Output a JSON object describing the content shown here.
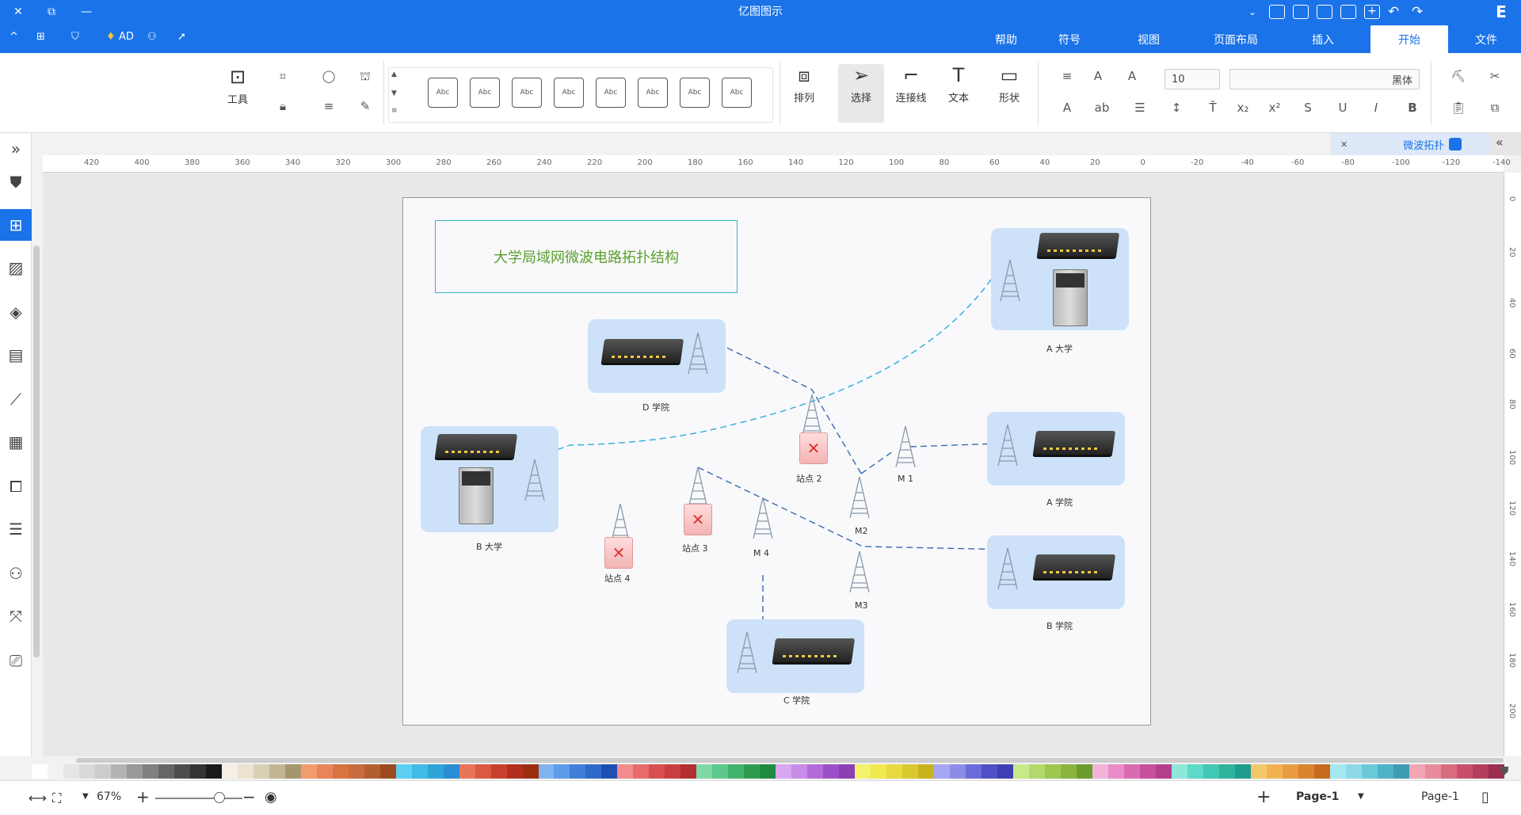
{
  "app": {
    "title": "亿图图示"
  },
  "titlebar": {
    "mirror_logo": "E",
    "quick_icons": [
      "redo-icon",
      "undo-icon",
      "new-icon",
      "open-icon",
      "save-icon",
      "print-icon",
      "export-icon",
      "more-icon"
    ]
  },
  "menubar": {
    "tabs": [
      {
        "label": "文件",
        "active": false
      },
      {
        "label": "开始",
        "active": true
      },
      {
        "label": "插入",
        "active": false
      },
      {
        "label": "页面布局",
        "active": false
      },
      {
        "label": "视图",
        "active": false
      },
      {
        "label": "符号",
        "active": false
      },
      {
        "label": "帮助",
        "active": false
      }
    ],
    "right_items": {
      "ad": "AD"
    }
  },
  "ribbon": {
    "font_name": "黑体",
    "font_size": "10",
    "shape_label": "形状",
    "text_label": "文本",
    "connector_label": "连接线",
    "select_label": "选择",
    "arrange_label": "排列",
    "tools_label": "工具",
    "style_box_label": "Abc",
    "style_count": 8
  },
  "doc_tab": {
    "name": "微波拓扑"
  },
  "ruler_top": {
    "ticks": [
      "-140",
      "-120",
      "-100",
      "-80",
      "-60",
      "-40",
      "-20",
      "0",
      "20",
      "40",
      "60",
      "80",
      "100",
      "120",
      "140",
      "160",
      "180",
      "200",
      "220",
      "240",
      "260",
      "280",
      "300",
      "320",
      "340",
      "360",
      "380",
      "400",
      "420"
    ]
  },
  "ruler_right": {
    "ticks": [
      "0",
      "20",
      "40",
      "60",
      "80",
      "100",
      "120",
      "140",
      "160",
      "180",
      "200"
    ]
  },
  "diagram": {
    "title": "大学局域网微波电路拓扑结构",
    "nodes": {
      "a_univ": "A 大学",
      "b_univ": "B 大学",
      "d_school": "D 学院",
      "a_school": "A 学院",
      "b_school": "B 学院",
      "c_school": "C 学院",
      "station1": "M 1",
      "station2": "M2",
      "station3": "M3",
      "station4": "M 4",
      "site2": "站点 2",
      "site3": "站点 3",
      "site4": "站点 4"
    }
  },
  "palette": {
    "colors": [
      "#ffffff",
      "#f2f2f2",
      "#e6e6e6",
      "#d9d9d9",
      "#cccccc",
      "#b3b3b3",
      "#999999",
      "#808080",
      "#666666",
      "#4d4d4d",
      "#333333",
      "#1a1a1a",
      "#f5f0e6",
      "#ebe3cf",
      "#d9cfb3",
      "#c2b591",
      "#a69670",
      "#f29c6b",
      "#e8845a",
      "#d9733f",
      "#c86b3f",
      "#b35e2e",
      "#9c4a1f",
      "#5ccff2",
      "#3fbbe8",
      "#2ea5d9",
      "#2a8dd4",
      "#e8745a",
      "#d95a3f",
      "#c8412e",
      "#b32e1f",
      "#9c2e0f",
      "#7fb3f2",
      "#5c9ce8",
      "#3f7fd9",
      "#2e6bc8",
      "#1f4fb3",
      "#f28c8c",
      "#e86b6b",
      "#d94f4f",
      "#c83f3f",
      "#b32e2e",
      "#7fd9a6",
      "#5cc88c",
      "#3fb36b",
      "#2e9c4f",
      "#1f8c3f",
      "#d9a6f2",
      "#c88ce8",
      "#b36bd9",
      "#9c4fc8",
      "#8c3fb3",
      "#f2f26b",
      "#f2e84f",
      "#e8d93f",
      "#d9c82e",
      "#c8b31f",
      "#a6a6f2",
      "#8c8ce8",
      "#6b6bd9",
      "#4f4fc8",
      "#3f3fb3",
      "#c8e88c",
      "#b3d96b",
      "#9cc84f",
      "#8cb33f",
      "#6b9c2e",
      "#f2b3d9",
      "#e88cc8",
      "#d96bb3",
      "#c84f9c",
      "#b33f8c",
      "#8ce8d9",
      "#5cd9c8",
      "#3fc8b3",
      "#2eb39c",
      "#1f9c8c",
      "#f2c86b",
      "#f2b34f",
      "#e89c3f",
      "#d9842e",
      "#c86b1f",
      "#a6e8f2",
      "#8cd9e8",
      "#6bc8d9",
      "#4fb3c8",
      "#3f9cb3",
      "#f2a6b3",
      "#e88c9c",
      "#d96b7f",
      "#c84f6b",
      "#b33f5c",
      "#9c2e4f"
    ]
  },
  "statusbar": {
    "page_tab": "Page-1",
    "page_selector": "Page-1",
    "zoom": "67%"
  }
}
